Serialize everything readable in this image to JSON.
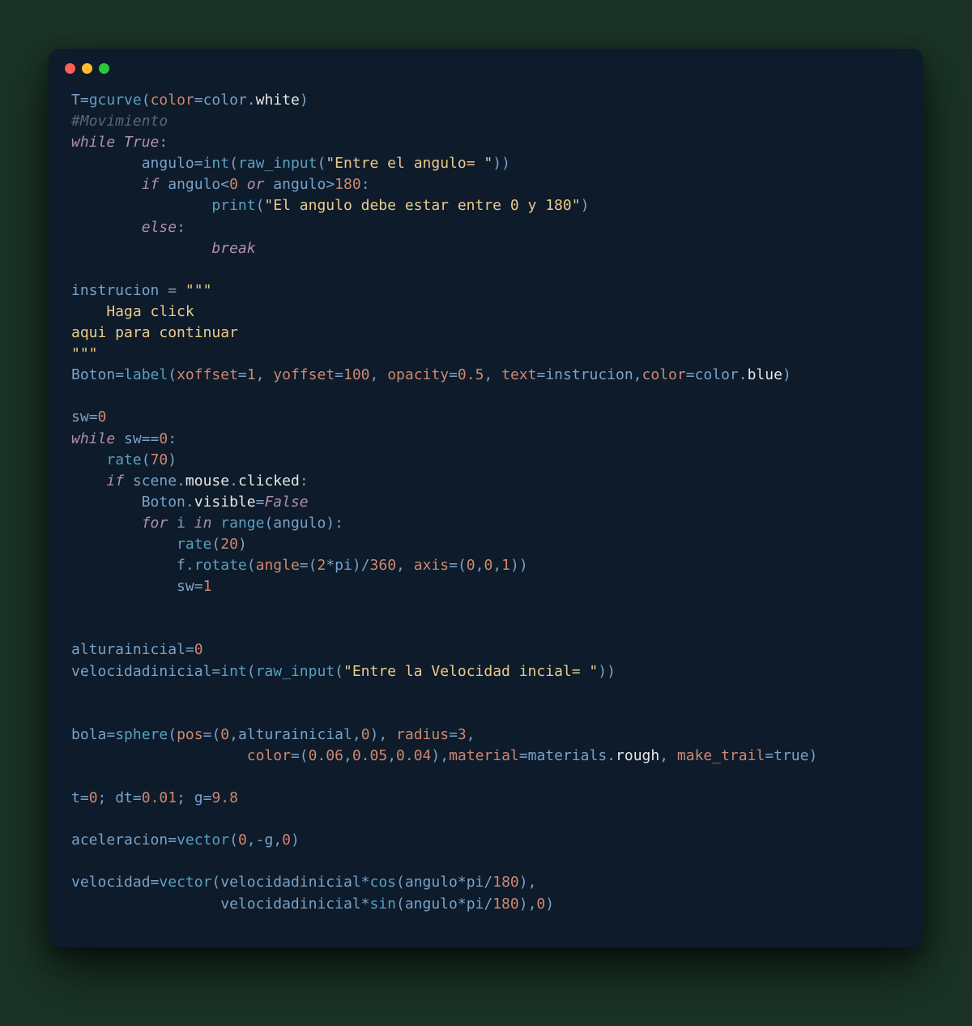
{
  "code": {
    "line1": {
      "a": "T",
      "b": "=",
      "c": "gcurve",
      "d": "(",
      "e": "color",
      "f": "=",
      "g": "color",
      "h": ".",
      "i": "white",
      "j": ")"
    },
    "line2": "#Movimiento",
    "line3": {
      "a": "while",
      "b": " ",
      "c": "True",
      "d": ":"
    },
    "line4": {
      "indent": "        ",
      "a": "angulo",
      "b": "=",
      "c": "int",
      "d": "(",
      "e": "raw_input",
      "f": "(",
      "g": "\"Entre el angulo= \"",
      "h": "))"
    },
    "line5": {
      "indent": "        ",
      "a": "if",
      "b": " angulo",
      "c": "<",
      "d": "0",
      "e": " ",
      "f": "or",
      "g": " angulo",
      "h": ">",
      "i": "180",
      "j": ":"
    },
    "line6": {
      "indent": "                ",
      "a": "print",
      "b": "(",
      "c": "\"El angulo debe estar entre 0 y 180\"",
      "d": ")"
    },
    "line7": {
      "indent": "        ",
      "a": "else",
      "b": ":"
    },
    "line8": {
      "indent": "                ",
      "a": "break"
    },
    "line9": "",
    "line10": {
      "a": "instrucion ",
      "b": "=",
      "c": " ",
      "d": "\"\"\""
    },
    "line11": "    Haga click",
    "line12": "aqui para continuar",
    "line13": "\"\"\"",
    "line14": {
      "a": "Boton",
      "b": "=",
      "c": "label",
      "d": "(",
      "e": "xoffset",
      "f": "=",
      "g": "1",
      "h": ", ",
      "i": "yoffset",
      "j": "=",
      "k": "100",
      "l": ", ",
      "m": "opacity",
      "n": "=",
      "o": "0.5",
      "p": ", ",
      "q": "text",
      "r": "=",
      "s": "instrucion,",
      "t": "color",
      "u": "=",
      "v": "color",
      "w": ".",
      "x": "blue",
      "y": ")"
    },
    "line15": "",
    "line16": {
      "a": "sw",
      "b": "=",
      "c": "0"
    },
    "line17": {
      "a": "while",
      "b": " sw",
      "c": "==",
      "d": "0",
      "e": ":"
    },
    "line18": {
      "indent": "    ",
      "a": "rate",
      "b": "(",
      "c": "70",
      "d": ")"
    },
    "line19": {
      "indent": "    ",
      "a": "if",
      "b": " scene",
      "c": ".",
      "d": "mouse",
      "e": ".",
      "f": "clicked",
      "g": ":"
    },
    "line20": {
      "indent": "        ",
      "a": "Boton",
      "b": ".",
      "c": "visible",
      "d": "=",
      "e": "False"
    },
    "line21": {
      "indent": "        ",
      "a": "for",
      "b": " i ",
      "c": "in",
      "d": " ",
      "e": "range",
      "f": "(angulo):"
    },
    "line22": {
      "indent": "            ",
      "a": "rate",
      "b": "(",
      "c": "20",
      "d": ")"
    },
    "line23": {
      "indent": "            ",
      "a": "f",
      "b": ".",
      "c": "rotate",
      "d": "(",
      "e": "angle",
      "f": "=",
      "g": "(",
      "h": "2",
      "i": "*",
      "j": "pi)",
      "k": "/",
      "l": "360",
      "m": ", ",
      "n": "axis",
      "o": "=",
      "p": "(",
      "q": "0",
      "r": ",",
      "s": "0",
      "t": ",",
      "u": "1",
      "v": "))"
    },
    "line24": {
      "indent": "            ",
      "a": "sw",
      "b": "=",
      "c": "1"
    },
    "line25": "",
    "line26": "",
    "line27": {
      "a": "alturainicial",
      "b": "=",
      "c": "0"
    },
    "line28": {
      "a": "velocidadinicial",
      "b": "=",
      "c": "int",
      "d": "(",
      "e": "raw_input",
      "f": "(",
      "g": "\"Entre la Velocidad incial= \"",
      "h": "))"
    },
    "line29": "",
    "line30": "",
    "line31": {
      "a": "bola",
      "b": "=",
      "c": "sphere",
      "d": "(",
      "e": "pos",
      "f": "=",
      "g": "(",
      "h": "0",
      "i": ",alturainicial,",
      "j": "0",
      "k": "), ",
      "l": "radius",
      "m": "=",
      "n": "3",
      "o": ","
    },
    "line32": {
      "indent": "                    ",
      "a": "color",
      "b": "=",
      "c": "(",
      "d": "0.06",
      "e": ",",
      "f": "0.05",
      "g": ",",
      "h": "0.04",
      "i": "),",
      "j": "material",
      "k": "=",
      "l": "materials",
      "m": ".",
      "n": "rough",
      "o": ", ",
      "p": "make_trail",
      "q": "=",
      "r": "true)"
    },
    "line33": "",
    "line34": {
      "a": "t",
      "b": "=",
      "c": "0",
      "d": "; dt",
      "e": "=",
      "f": "0.01",
      "g": "; g",
      "h": "=",
      "i": "9.8"
    },
    "line35": "",
    "line36": {
      "a": "aceleracion",
      "b": "=",
      "c": "vector",
      "d": "(",
      "e": "0",
      "f": ",",
      "g": "-",
      "h": "g,",
      "i": "0",
      "j": ")"
    },
    "line37": "",
    "line38": {
      "a": "velocidad",
      "b": "=",
      "c": "vector",
      "d": "(velocidadinicial",
      "e": "*",
      "f": "cos",
      "g": "(angulo",
      "h": "*",
      "i": "pi",
      "j": "/",
      "k": "180",
      "l": "),"
    },
    "line39": {
      "indent": "                 ",
      "a": "velocidadinicial",
      "b": "*",
      "c": "sin",
      "d": "(angulo",
      "e": "*",
      "f": "pi",
      "g": "/",
      "h": "180",
      "i": "),",
      "j": "0",
      "k": ")"
    }
  }
}
